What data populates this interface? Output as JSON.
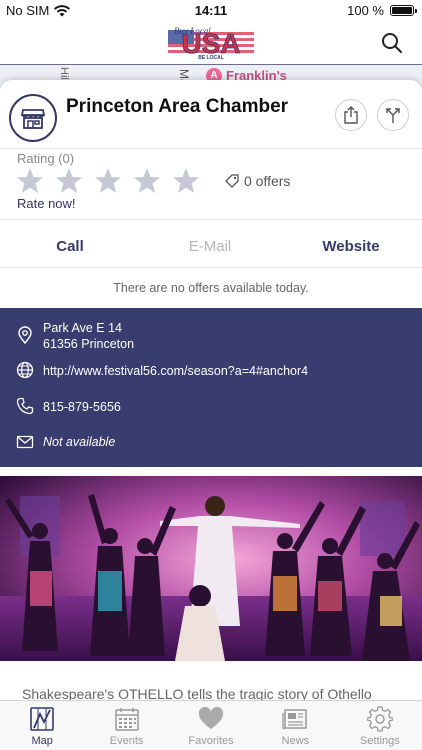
{
  "status_bar": {
    "carrier": "No SIM",
    "time": "14:11",
    "battery": "100 %"
  },
  "header": {
    "logo_text": "USA",
    "logo_subtext": "BE LOCAL",
    "logo_script": "Buy Local"
  },
  "map": {
    "label_1": "Hill",
    "label_2": "Main",
    "pin_letter": "A",
    "pin_label": "Franklin's"
  },
  "place": {
    "title": "Princeton Area Chamber",
    "rating_label": "Rating (0)",
    "rating_value": 0,
    "rating_max": 5,
    "offers_text": "0 offers",
    "rate_now": "Rate now!"
  },
  "actions": {
    "call": "Call",
    "email": "E-Mail",
    "website": "Website"
  },
  "no_offers": "There are no offers available today.",
  "info": {
    "address_line1": "Park Ave E 14",
    "address_line2": "61356 Princeton",
    "url": "http://www.festival56.com/season?a=4#anchor4",
    "phone": "815-879-5656",
    "email": "Not available"
  },
  "description": "Shakespeare's OTHELLO tells the tragic story of Othello",
  "tabs": [
    {
      "label": "Map",
      "icon": "map-icon"
    },
    {
      "label": "Events",
      "icon": "calendar-icon"
    },
    {
      "label": "Favorites",
      "icon": "heart-icon"
    },
    {
      "label": "News",
      "icon": "newspaper-icon"
    },
    {
      "label": "Settings",
      "icon": "gear-icon"
    }
  ],
  "colors": {
    "accent": "#393c6e",
    "map_pin": "#ec6a97",
    "star_empty": "#c6c8d6"
  }
}
